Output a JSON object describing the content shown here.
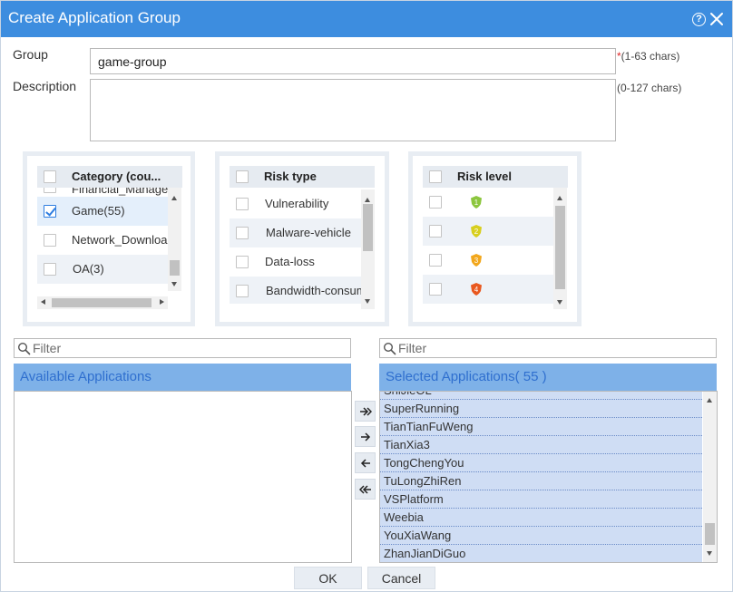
{
  "dialog": {
    "title": "Create Application Group",
    "help_glyph": "?",
    "icons": [
      "help-icon",
      "close-icon"
    ],
    "accent_color": "#3d8ddf"
  },
  "form": {
    "group_label": "Group",
    "group_value": "game-group",
    "group_required_mark": "*",
    "group_hint": "(1-63 chars)",
    "description_label": "Description",
    "description_value": "",
    "description_hint": "(0-127 chars)"
  },
  "category_panel": {
    "header": "Category (cou...",
    "items": [
      {
        "label": "Financial_Managem",
        "checked": false
      },
      {
        "label": "Game(55)",
        "checked": true
      },
      {
        "label": "Network_Download",
        "checked": false
      },
      {
        "label": "OA(3)",
        "checked": false
      }
    ]
  },
  "risk_type_panel": {
    "header": "Risk type",
    "items": [
      {
        "label": "Vulnerability",
        "checked": false
      },
      {
        "label": "Malware-vehicle",
        "checked": false
      },
      {
        "label": "Data-loss",
        "checked": false
      },
      {
        "label": "Bandwidth-consuming",
        "checked": false
      }
    ]
  },
  "risk_level_panel": {
    "header": "Risk level",
    "items": [
      {
        "level": "1",
        "color": "#8cc63e",
        "checked": false
      },
      {
        "level": "2",
        "color": "#d8cf1e",
        "checked": false
      },
      {
        "level": "3",
        "color": "#f2a71c",
        "checked": false
      },
      {
        "level": "4",
        "color": "#e9581f",
        "checked": false
      }
    ]
  },
  "available": {
    "filter_placeholder": "Filter",
    "header": "Available Applications",
    "items": []
  },
  "selected": {
    "filter_placeholder": "Filter",
    "header": "Selected Applications( 55 )",
    "partial_item": "ShiJieOL",
    "items": [
      "SuperRunning",
      "TianTianFuWeng",
      "TianXia3",
      "TongChengYou",
      "TuLongZhiRen",
      "VSPlatform",
      "Weebia",
      "YouXiaWang",
      "ZhanJianDiGuo"
    ]
  },
  "transfer_buttons": [
    "add-all",
    "add-selected",
    "remove-selected",
    "remove-all"
  ],
  "buttons": {
    "ok": "OK",
    "cancel": "Cancel"
  }
}
